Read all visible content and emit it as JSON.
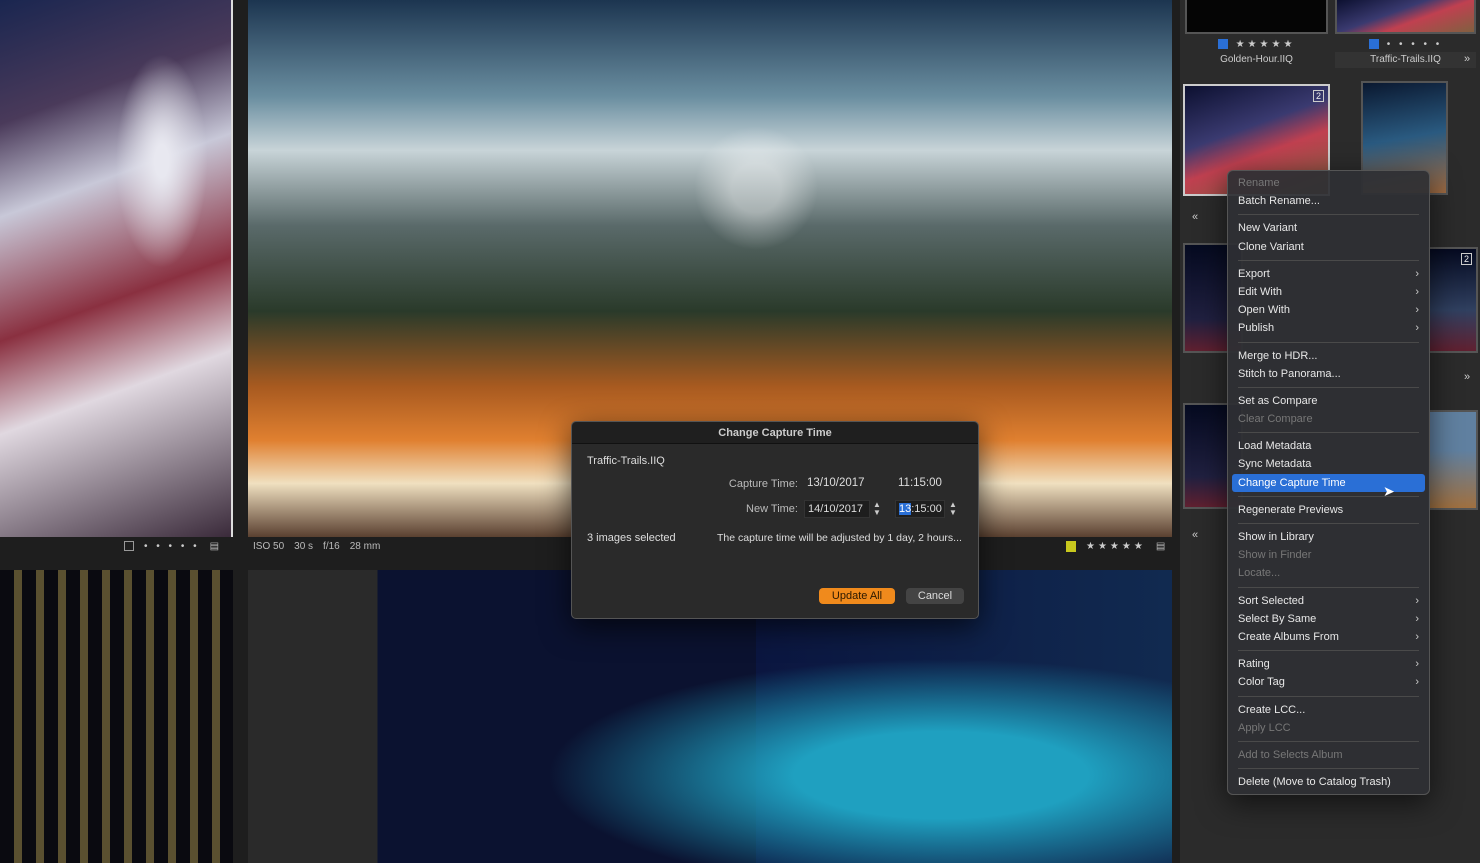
{
  "viewer": {
    "left_info": {
      "rating_dots": "• • • • •"
    },
    "main_info": {
      "iso": "ISO 50",
      "shutter": "30 s",
      "aperture": "f/16",
      "focal": "28 mm",
      "stars": "★★★★★",
      "color_tag": "#c8c81e"
    }
  },
  "browser": {
    "thumbs": [
      {
        "name": "Golden-Hour.IIQ",
        "stars": "★★★★★",
        "color_tag": "#2a6fd6"
      },
      {
        "name": "Traffic-Trails.IIQ",
        "stars": "• • • • •",
        "color_tag": "#2a6fd6"
      }
    ],
    "badges": [
      "2",
      "2"
    ],
    "nav_next": "»",
    "nav_prev": "«"
  },
  "dialog": {
    "title": "Change Capture Time",
    "filename": "Traffic-Trails.IIQ",
    "capture_label": "Capture Time:",
    "capture_date": "13/10/2017",
    "capture_time": "11:15:00",
    "new_label": "New Time:",
    "new_date": "14/10/2017",
    "new_time_hour": "13",
    "new_time_rest": ":15:00",
    "selected_count": "3 images selected",
    "adjust_note": "The capture time will be adjusted by 1 day, 2 hours...",
    "update_label": "Update All",
    "cancel_label": "Cancel"
  },
  "menu": {
    "items": [
      {
        "label": "Rename",
        "disabled": true
      },
      {
        "label": "Batch Rename..."
      },
      {
        "sep": true
      },
      {
        "label": "New Variant"
      },
      {
        "label": "Clone Variant"
      },
      {
        "sep": true
      },
      {
        "label": "Export",
        "submenu": true
      },
      {
        "label": "Edit With",
        "submenu": true
      },
      {
        "label": "Open With",
        "submenu": true
      },
      {
        "label": "Publish",
        "submenu": true
      },
      {
        "sep": true
      },
      {
        "label": "Merge to HDR..."
      },
      {
        "label": "Stitch to Panorama..."
      },
      {
        "sep": true
      },
      {
        "label": "Set as Compare"
      },
      {
        "label": "Clear Compare",
        "disabled": true
      },
      {
        "sep": true
      },
      {
        "label": "Load Metadata"
      },
      {
        "label": "Sync Metadata"
      },
      {
        "label": "Change Capture Time",
        "highlighted": true
      },
      {
        "sep": true
      },
      {
        "label": "Regenerate Previews"
      },
      {
        "sep": true
      },
      {
        "label": "Show in Library"
      },
      {
        "label": "Show in Finder",
        "disabled": true
      },
      {
        "label": "Locate...",
        "disabled": true
      },
      {
        "sep": true
      },
      {
        "label": "Sort Selected",
        "submenu": true
      },
      {
        "label": "Select By Same",
        "submenu": true
      },
      {
        "label": "Create Albums From",
        "submenu": true
      },
      {
        "sep": true
      },
      {
        "label": "Rating",
        "submenu": true
      },
      {
        "label": "Color Tag",
        "submenu": true
      },
      {
        "sep": true
      },
      {
        "label": "Create LCC..."
      },
      {
        "label": "Apply LCC",
        "disabled": true
      },
      {
        "sep": true
      },
      {
        "label": "Add to Selects Album",
        "disabled": true
      },
      {
        "sep": true
      },
      {
        "label": "Delete (Move to Catalog Trash)"
      }
    ]
  }
}
